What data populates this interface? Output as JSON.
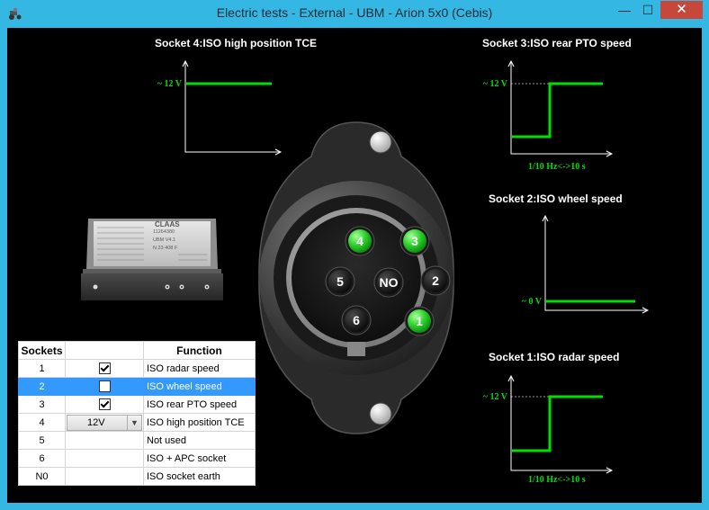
{
  "window": {
    "title": "Electric tests - External - UBM - Arion 5x0 (Cebis)",
    "min_glyph": "—",
    "max_glyph": "☐",
    "close_glyph": "✕"
  },
  "colors": {
    "signal": "#00e000",
    "accent": "#35b7e4",
    "close": "#c7473b",
    "selection": "#3399ff"
  },
  "sockets": {
    "s4": {
      "title": "Socket 4:ISO high position TCE",
      "level_label": "~ 12 V"
    },
    "s3": {
      "title": "Socket 3:ISO rear PTO speed",
      "level_label": "~ 12 V",
      "freq_label": "1/10 Hz<->10 s"
    },
    "s2": {
      "title": "Socket 2:ISO wheel speed",
      "level_label": "~ 0 V"
    },
    "s1": {
      "title": "Socket 1:ISO radar speed",
      "level_label": "~ 12 V",
      "freq_label": "1/10 Hz<->10 s"
    }
  },
  "connector": {
    "pins": [
      {
        "label": "4",
        "active": true
      },
      {
        "label": "3",
        "active": true
      },
      {
        "label": "5",
        "active": false
      },
      {
        "label": "NO",
        "active": false
      },
      {
        "label": "2",
        "active": false
      },
      {
        "label": "6",
        "active": false
      },
      {
        "label": "1",
        "active": true
      }
    ]
  },
  "table": {
    "headers": {
      "sockets": "Sockets",
      "check": "",
      "function": "Function"
    },
    "rows": [
      {
        "socket": "1",
        "function": "ISO radar speed",
        "checked": true
      },
      {
        "socket": "2",
        "function": "ISO wheel speed",
        "checked": false,
        "selected": true
      },
      {
        "socket": "3",
        "function": "ISO rear PTO speed",
        "checked": true
      },
      {
        "socket": "4",
        "function": "ISO high position TCE",
        "combo_value": "12V"
      },
      {
        "socket": "5",
        "function": "Not used"
      },
      {
        "socket": "6",
        "function": "ISO + APC socket"
      },
      {
        "socket": "N0",
        "function": "ISO socket earth"
      }
    ]
  },
  "device": {
    "lines": [
      "11264380",
      "UBM V4.1",
      "N 23 408 F"
    ],
    "brand": "CLAAS"
  }
}
